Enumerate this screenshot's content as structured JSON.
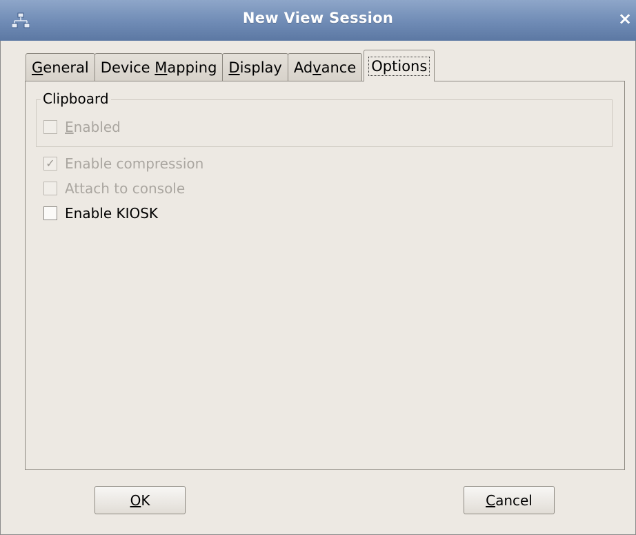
{
  "window": {
    "title": "New View Session",
    "icon": "network-icon",
    "close_glyph": "×"
  },
  "tabs": [
    {
      "pre": "",
      "mnemonic": "G",
      "post": "eneral"
    },
    {
      "pre": "Device ",
      "mnemonic": "M",
      "post": "apping"
    },
    {
      "pre": "",
      "mnemonic": "D",
      "post": "isplay"
    },
    {
      "pre": "Ad",
      "mnemonic": "v",
      "post": "ance"
    },
    {
      "pre": "",
      "mnemonic": "",
      "post": "Options"
    }
  ],
  "active_tab": "Options",
  "clipboard_group": {
    "title": "Clipboard",
    "enabled": {
      "mnemonic": "E",
      "rest": "nabled",
      "checked": false,
      "disabled": true
    }
  },
  "options": {
    "enable_compression": {
      "label": "Enable compression",
      "checked": true,
      "disabled": true
    },
    "attach_to_console": {
      "label": "Attach to console",
      "checked": false,
      "disabled": true
    },
    "enable_kiosk": {
      "label": "Enable KIOSK",
      "checked": false,
      "disabled": false
    }
  },
  "buttons": {
    "ok": {
      "mnemonic": "O",
      "rest": "K"
    },
    "cancel": {
      "mnemonic": "C",
      "rest": "ancel"
    }
  },
  "check_glyph": "✓",
  "colors": {
    "titlebar": "#6f8bb5",
    "background": "#ede9e3",
    "disabled_text": "#aaa6a0"
  }
}
